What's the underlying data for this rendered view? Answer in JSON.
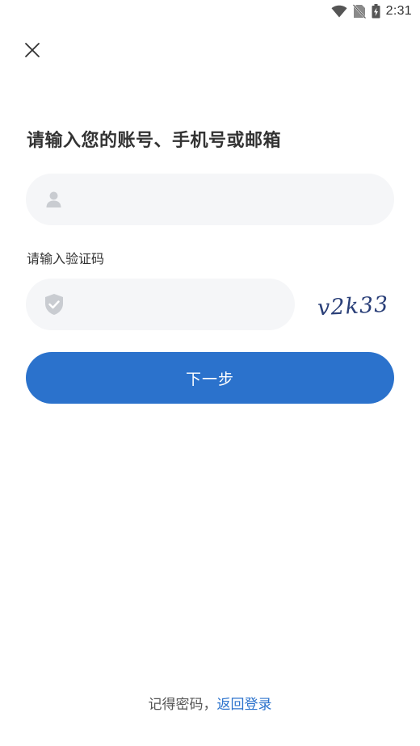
{
  "status_bar": {
    "time": "2:31",
    "icons": [
      "wifi-icon",
      "no-sim-icon",
      "battery-charging-icon"
    ]
  },
  "header": {
    "close_icon": "close-icon"
  },
  "form": {
    "title": "请输入您的账号、手机号或邮箱",
    "account": {
      "icon": "user-icon",
      "value": "",
      "placeholder": ""
    },
    "captcha": {
      "label": "请输入验证码",
      "icon": "shield-check-icon",
      "value": "",
      "placeholder": "",
      "image_text": "v2k33"
    },
    "next_label": "下一步"
  },
  "footer": {
    "remember_text": "记得密码，",
    "back_link": "返回登录"
  },
  "colors": {
    "primary": "#2b72cc",
    "field_bg": "#f5f6f8",
    "text": "#333333",
    "icon_gray": "#c9ccd1"
  }
}
